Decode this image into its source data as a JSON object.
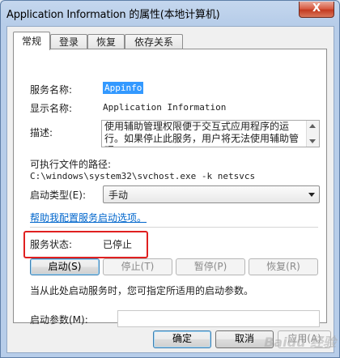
{
  "window": {
    "title": "Application Information 的属性(本地计算机)",
    "close_glyph": "X"
  },
  "tabs": [
    {
      "label": "常规",
      "active": true
    },
    {
      "label": "登录",
      "active": false
    },
    {
      "label": "恢复",
      "active": false
    },
    {
      "label": "依存关系",
      "active": false
    }
  ],
  "general": {
    "service_name_label": "服务名称:",
    "service_name_value": "Appinfo",
    "display_name_label": "显示名称:",
    "display_name_value": "Application Information",
    "description_label": "描述:",
    "description_value": "使用辅助管理权限便于交互式应用程序的运行。如果停止此服务，用户将无法使用辅助管理",
    "exe_path_label": "可执行文件的路径:",
    "exe_path_value": "C:\\windows\\system32\\svchost.exe -k netsvcs",
    "startup_type_label": "启动类型(E):",
    "startup_type_value": "手动",
    "help_link": "帮助我配置服务启动选项。",
    "status_label": "服务状态:",
    "status_value": "已停止",
    "buttons": {
      "start": "启动(S)",
      "stop": "停止(T)",
      "pause": "暂停(P)",
      "resume": "恢复(R)"
    },
    "hint": "当从此处启动服务时，您可指定所适用的启动参数。",
    "params_label": "启动参数(M):",
    "params_value": ""
  },
  "footer": {
    "ok": "确定",
    "cancel": "取消",
    "apply": "应用(A)"
  },
  "watermark": "Baidu 经验",
  "colors": {
    "highlight_border": "#e02020",
    "link": "#0066cc",
    "selection": "#3399ff"
  }
}
